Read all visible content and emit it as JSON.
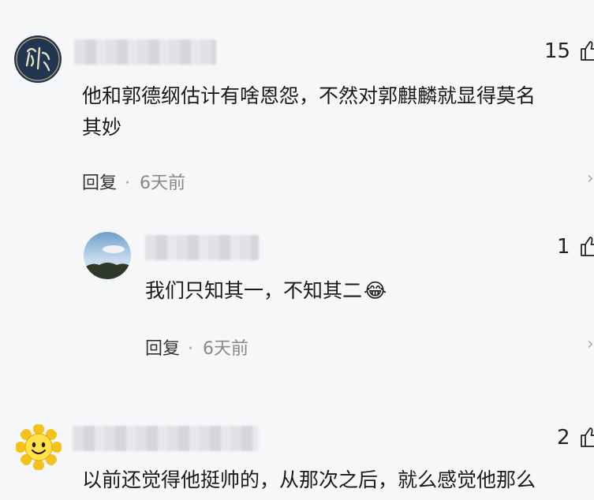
{
  "comments": [
    {
      "likes": "15",
      "text_line1": "他和郭德纲估计有啥恩怨，不然对郭麒麟就显得莫名",
      "text_line2": "其妙",
      "reply_label": "回复",
      "time": "6天前"
    },
    {
      "likes": "1",
      "text_line1": "我们只知其一，不知其二",
      "emoji": "😂",
      "reply_label": "回复",
      "time": "6天前"
    },
    {
      "likes": "2",
      "text_line1": "以前还觉得他挺帅的，从那次之后，就么感觉他那么"
    }
  ],
  "icons": {
    "like": "thumbs-up-icon",
    "more": "chevron-right-icon"
  },
  "colors": {
    "background": "#f6f7f9",
    "time": "#888888"
  }
}
